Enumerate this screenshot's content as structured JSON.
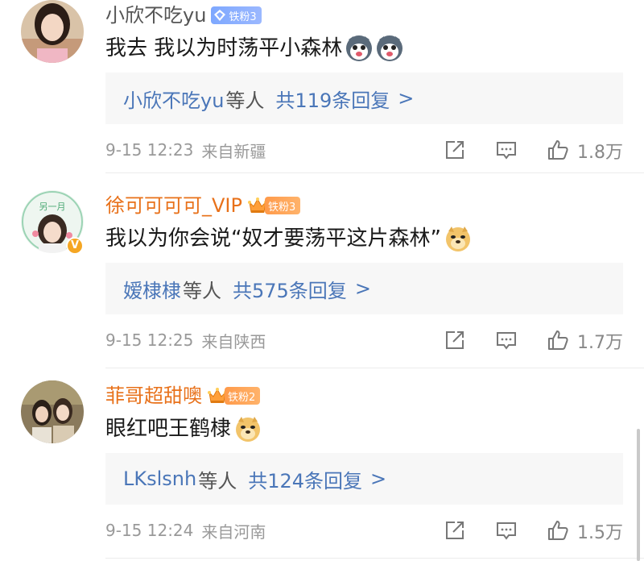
{
  "comments": [
    {
      "username": "小欣不吃yu",
      "fan_badge": "铁粉3",
      "text": "我去 我以为时荡平小森林",
      "emojis": [
        "husky-emoji",
        "husky-emoji"
      ],
      "reply_user": "小欣不吃yu",
      "reply_mid": "等人",
      "reply_count": "共119条回复",
      "reply_arrow": ">",
      "time": "9-15 12:23",
      "location": "来自新疆",
      "likes": "1.8万"
    },
    {
      "username": "徐可可可可_VIP",
      "fan_badge": "铁粉3",
      "text": "我以为你会说“奴才要荡平这片森林”",
      "emojis": [
        "doge-emoji"
      ],
      "reply_user": "嫒棣棣",
      "reply_mid": "等人",
      "reply_count": "共575条回复",
      "reply_arrow": ">",
      "time": "9-15 12:25",
      "location": "来自陕西",
      "likes": "1.7万",
      "avatar_text": "另一月"
    },
    {
      "username": "菲哥超甜噢",
      "fan_badge": "铁粉2",
      "text": "眼红吧王鹤棣",
      "emojis": [
        "doge-emoji"
      ],
      "reply_user": "LKslsnh",
      "reply_mid": "等人",
      "reply_count": "共124条回复",
      "reply_arrow": ">",
      "time": "9-15 12:24",
      "location": "来自河南",
      "likes": "1.5万"
    }
  ],
  "colors": {
    "vip_name": "#e8711a",
    "reply_link": "#4a76b8",
    "meta_gray": "#999999",
    "fan_badge_blue": "#8aaeff",
    "fan_badge_orange": "#ff9f52",
    "verified": "#f5a623"
  },
  "icons": {
    "share": "share-square-icon",
    "comment": "comment-bubble-icon",
    "like": "thumbs-up-icon"
  }
}
